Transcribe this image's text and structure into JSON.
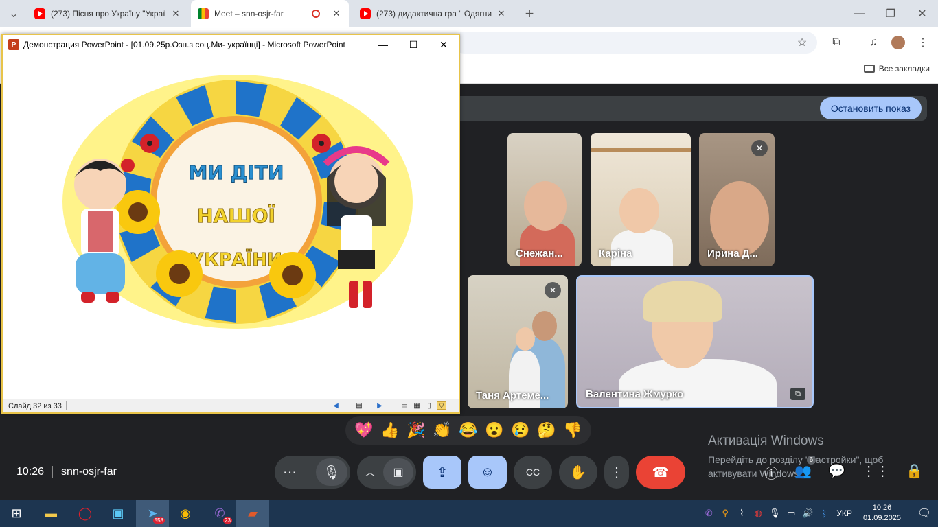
{
  "browser": {
    "tabs": [
      {
        "title": "(273) Пісня про Україну \"Украї",
        "active": false,
        "favicon": "youtube-icon"
      },
      {
        "title": "Meet – snn-osjr-far",
        "active": true,
        "favicon": "meet-icon"
      },
      {
        "title": "(273) дидактична гра \" Одягни",
        "active": false,
        "favicon": "youtube-icon"
      }
    ],
    "new_tab": "+",
    "bookmarks_all": "Все закладки"
  },
  "ppt": {
    "window_title": "Демонстрация PowerPoint - [01.09.25р.Озн.з соц.Ми- українці] - Microsoft PowerPoint",
    "app_icon_letter": "P",
    "slide_counter": "Слайд 32 из 33",
    "slide_text": {
      "line1": "МИ ДІТИ",
      "line2": "НАШОЇ",
      "line3": "УКРАЇНИ"
    }
  },
  "meet": {
    "stop_presenting": "Остановить показ",
    "participants": [
      {
        "name": "Снежан...",
        "muted": false
      },
      {
        "name": "Каріна",
        "muted": false
      },
      {
        "name": "Ирина Д...",
        "muted": true
      },
      {
        "name": "Таня Артеме...",
        "muted": true
      },
      {
        "name": "Валентина Жмурко",
        "muted": false
      }
    ],
    "reactions": [
      "💖",
      "👍",
      "🎉",
      "👏",
      "😂",
      "😮",
      "😢",
      "🤔",
      "👎"
    ],
    "time": "10:26",
    "meeting_code": "snn-osjr-far",
    "people_count": "6"
  },
  "activation": {
    "title": "Активація Windows",
    "body": "Перейдіть до розділу \"Настройки\", щоб активувати Windows."
  },
  "taskbar": {
    "telegram_badge": "558",
    "viber_badge": "23",
    "language": "УКР",
    "time": "10:26",
    "date": "01.09.2025"
  },
  "colors": {
    "meet_bg": "#202124",
    "accent_blue": "#a8c7fa",
    "end_call_red": "#ea4335",
    "ppt_border": "#e8c44a"
  }
}
